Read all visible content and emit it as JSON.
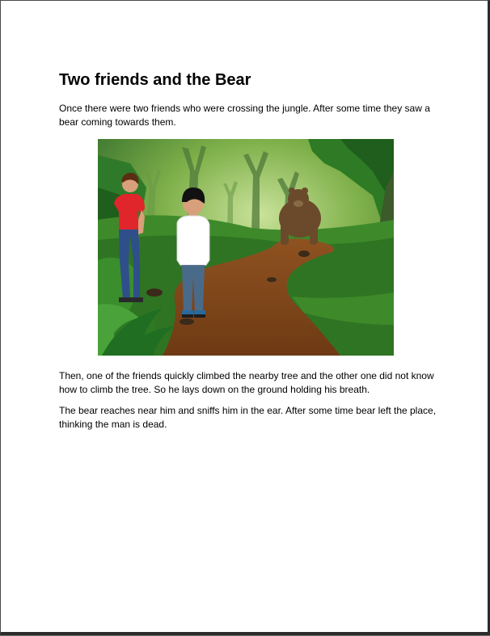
{
  "document": {
    "title": "Two friends and the Bear",
    "paragraphs": [
      "Once there were two friends who were crossing the jungle. After some time they saw a bear coming towards them.",
      "Then, one of the friends quickly climbed the nearby tree and the other one did not know how to climb the tree. So he lays down on the ground holding his breath.",
      "The bear reaches near him and sniffs him in the ear. After some time bear left the place, thinking the man is dead."
    ]
  },
  "colors": {
    "page_bg": "#ffffff",
    "jungle_green": "#3f8a2a",
    "path_brown": "#8a4a1c",
    "shirt_red": "#e0262a",
    "shirt_white": "#ffffff"
  }
}
